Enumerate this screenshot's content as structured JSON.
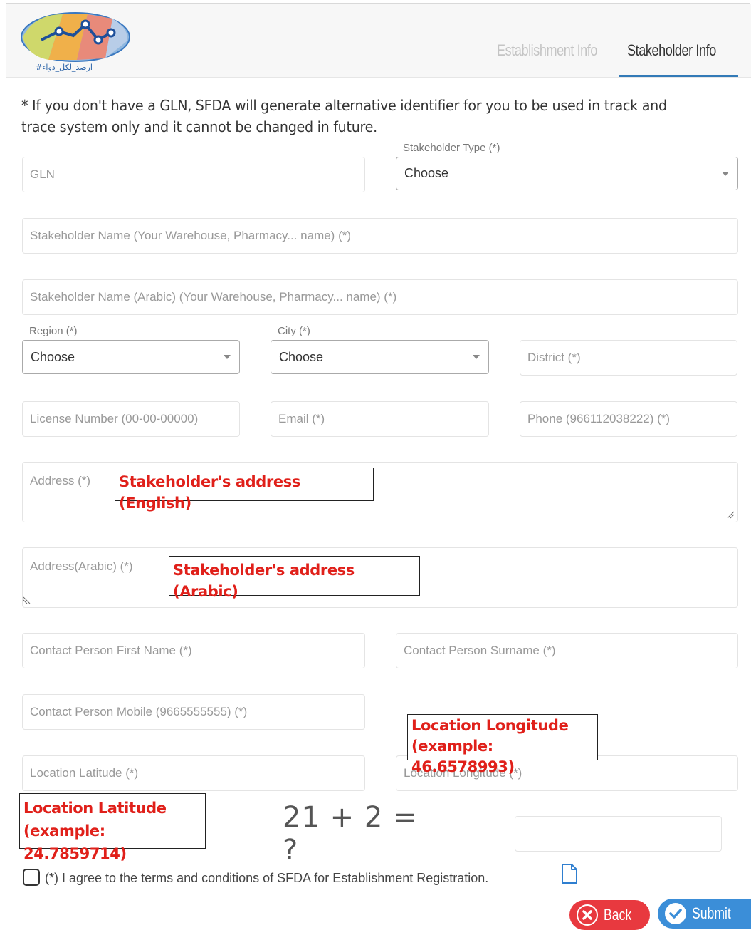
{
  "header": {
    "logo_text": "#ارصد_لكل_دواء",
    "tabs": [
      {
        "label": "Establishment Info",
        "active": false
      },
      {
        "label": "Stakeholder Info",
        "active": true
      }
    ]
  },
  "note": "* If you don't have a GLN, SFDA will generate alternative identifier for you to be used in track and trace system only and it cannot be changed in future.",
  "form": {
    "gln_placeholder": "GLN",
    "stakeholder_type_label": "Stakeholder Type (*)",
    "stakeholder_type_value": "Choose",
    "name_placeholder": "Stakeholder Name (Your Warehouse, Pharmacy... name) (*)",
    "name_ar_placeholder": "Stakeholder Name (Arabic) (Your Warehouse, Pharmacy... name) (*)",
    "region_label": "Region (*)",
    "region_value": "Choose",
    "city_label": "City (*)",
    "city_value": "Choose",
    "district_placeholder": "District (*)",
    "license_placeholder": "License Number (00-00-00000)",
    "email_placeholder": "Email (*)",
    "phone_placeholder": "Phone (966112038222) (*)",
    "address_placeholder": "Address (*)",
    "address_ar_placeholder": "Address(Arabic) (*)",
    "contact_first_placeholder": "Contact Person First Name (*)",
    "contact_surname_placeholder": "Contact Person Surname (*)",
    "contact_mobile_placeholder": "Contact Person Mobile (9665555555) (*)",
    "latitude_placeholder": "Location Latitude (*)",
    "longitude_placeholder": "Location Longitude (*)",
    "captcha_text": "21 + 2 = ?",
    "captcha_answer": "",
    "terms_text": "(*) I agree to the terms and conditions of SFDA for Establishment Registration."
  },
  "annotations": {
    "address_en": "Stakeholder's address (English)",
    "address_ar": "Stakeholder's address (Arabic)",
    "longitude_line1": "Location Longitude",
    "longitude_line2": "(example: 46.6578993)",
    "latitude_line1": "Location Latitude",
    "latitude_line2": "(example: 24.7859714)"
  },
  "buttons": {
    "back": "Back",
    "submit": "Submit"
  },
  "colors": {
    "active_tab_underline": "#337ab7",
    "annotation_text": "#e0201a",
    "back_button": "#e8393f",
    "submit_button": "#3b8ed8"
  },
  "icons": [
    "logo-icon",
    "chevron-down-icon",
    "document-icon",
    "close-circle-icon",
    "check-circle-icon"
  ]
}
